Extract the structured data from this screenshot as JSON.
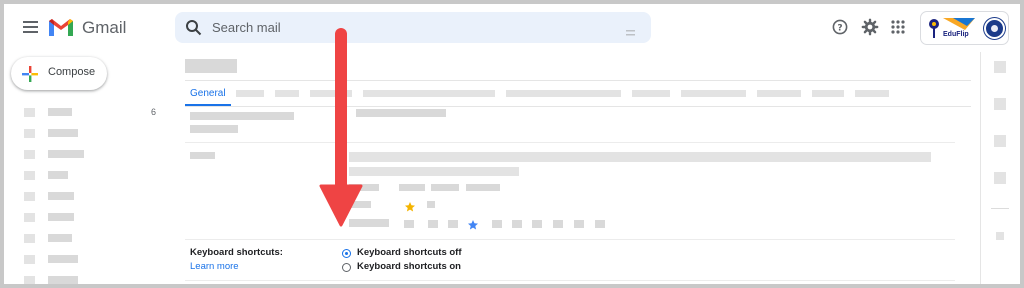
{
  "app": {
    "name": "Gmail"
  },
  "search": {
    "placeholder": "Search mail"
  },
  "compose": {
    "label": "Compose"
  },
  "sidebar": {
    "badge": "6"
  },
  "settings": {
    "active_tab": "General",
    "keyboard_shortcuts": {
      "label": "Keyboard shortcuts:",
      "learn_more": "Learn more",
      "options": [
        "Keyboard shortcuts off",
        "Keyboard shortcuts on"
      ],
      "selected": "Keyboard shortcuts off"
    }
  },
  "account_logo": {
    "text": "EduFlip"
  },
  "colors": {
    "accent": "#1a73e8",
    "arrow": "#ef4444",
    "star_yellow": "#f4b400",
    "star_blue": "#4285f4",
    "search_bg": "#eaf1fb",
    "placeholder": "#d9d9d9"
  },
  "icons": [
    "menu-icon",
    "gmail-logo-icon",
    "search-icon",
    "search-options-icon",
    "help-icon",
    "gear-icon",
    "apps-grid-icon",
    "account-logo",
    "avatar",
    "compose-plus-icon",
    "star-icon",
    "radio-icon",
    "annotation-arrow"
  ]
}
